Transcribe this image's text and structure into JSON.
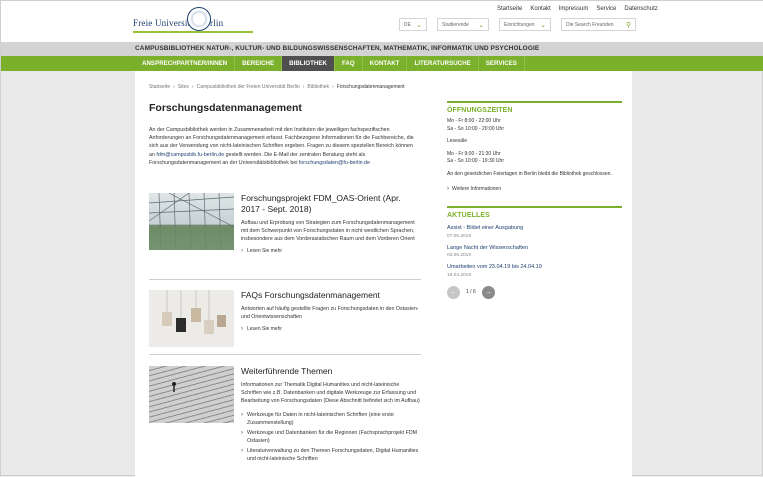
{
  "header": {
    "logo_text": "Freie Universität    Berlin",
    "top_links": [
      "Startseite",
      "Kontakt",
      "Impressum",
      "Service",
      "Datenschutz"
    ],
    "language_label": "DE",
    "audience_label": "Studierende",
    "institutions_label": "Einrichtungen",
    "search_placeholder": "Die Search Freunden"
  },
  "title_band": "CAMPUSBIBLIOTHEK NATUR-, KULTUR- UND BILDUNGSWISSENSCHAFTEN, MATHEMATIK, INFORMATIK UND PSYCHOLOGIE",
  "nav": {
    "items": [
      {
        "label": "ANSPRECHPARTNER/INNEN"
      },
      {
        "label": "BEREICHE"
      },
      {
        "label": "BIBLIOTHEK"
      },
      {
        "label": "FAQ"
      },
      {
        "label": "KONTAKT"
      },
      {
        "label": "LITERATURSUCHE"
      },
      {
        "label": "SERVICES"
      }
    ],
    "active_index": 2
  },
  "breadcrumb": {
    "items": [
      "Startseite",
      "Sites",
      "Campusbibliothek der Freien Universität Berlin",
      "Bibliothek"
    ],
    "current": "Forschungsdatenmanagement"
  },
  "main": {
    "title": "Forschungsdatenmanagement",
    "intro": "An der Campusbibliothek werden in Zusammenarbeit mit den Instituten die jeweiligen fachspezifischen Anforderungen an Forschungsdatenmanagement erfasst. Fachbezogene Informationen für die Fachbereiche, die sich aus der Verwendung von nicht-lateinischen Schriften ergeben. Fragen zu diesem speziellen Bereich können an",
    "intro_link": "fdm@campusbib.fu-berlin.de",
    "intro_tail": "gestellt werden. Die E-Mail der zentralen Beratung steht als Forschungsdatenmanagement an der Universitätsbibliothek bei",
    "intro_link2": "forschungsdaten@fu-berlin.de",
    "teasers": [
      {
        "title": "Forschungsprojekt FDM_OAS-Orient (Apr. 2017 - Sept. 2018)",
        "text": "Aufbau und Erprobung von Strategien zum Forschungsdatenmanagement mit dem Schwerpunkt von Forschungsdaten in nicht westlichen Sprachen, insbesondere aus dem Vorderasiatischen Raum und dem Vorderen Orient",
        "more": "Lesen Sie mehr"
      },
      {
        "title": "FAQs Forschungsdatenmanagement",
        "text": "Antworten auf häufig gestellte Fragen zu Forschungsdaten in den Ostasien- und Orientwissenschaften",
        "more": "Lesen Sie mehr"
      },
      {
        "title": "Weiterführende Themen",
        "text": "Informationen zur Thematik Digital Humanities und nicht-lateinische Schriften wie z.B. Datenbanken und digitale Werkzeuge zur Erfassung und Bearbeitung von Forschungsdaten (Diese Abschnitt befindet sich im Aufbau)",
        "links": [
          "Werkzeuge für Daten in nicht-lateinischen Schriften (eine erste Zusammenstellung)",
          "Werkzeuge und Datenbanken für die Regionen (Fachsprachprojekt FDM Ostasien)",
          "Literaturverwaltung zu den Themen Forschungsdaten, Digital Humanities und nicht-lateinische Schriften"
        ]
      }
    ]
  },
  "sidebar": {
    "hours": {
      "heading": "ÖFFNUNGSZEITEN",
      "line1": "Mo - Fr 8:00 - 22:00 Uhr",
      "line2": "Sa - So 10:00 - 20:00 Uhr",
      "label": "Lesesäle",
      "line3": "Mo - Fr 9:00 - 21:30 Uhr",
      "line4": "Sa - So 10:00 - 19:30 Uhr",
      "note": "An den gesetzlichen Feiertagen in Berlin bleibt die Bibliothek geschlossen.",
      "more": "Weitere Informationen"
    },
    "news": {
      "heading": "AKTUELLES",
      "items": [
        {
          "title": "Assist - Bildet einer Ausgabung",
          "date": "07.06.2019"
        },
        {
          "title": "Lange Nacht der Wissenschaften",
          "date": "03.06.2019"
        },
        {
          "title": "Umarbeiten vom 23.04.19 bis 24.04.19",
          "date": "18.04.2019"
        }
      ],
      "pager": "1 / 6"
    }
  }
}
